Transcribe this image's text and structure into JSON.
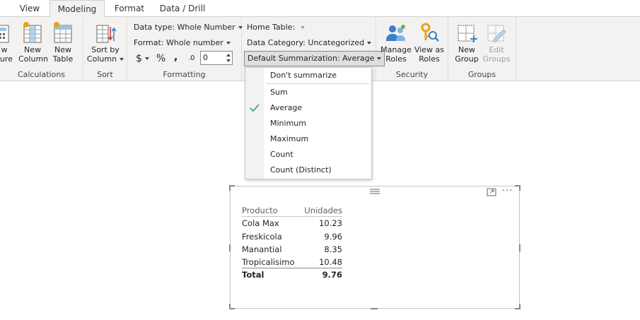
{
  "tabs": [
    "View",
    "Modeling",
    "Format",
    "Data / Drill"
  ],
  "ribbon": {
    "calculations": {
      "label": "Calculations",
      "new_measure": [
        "w",
        "sure"
      ],
      "new_column": [
        "New",
        "Column"
      ],
      "new_table": [
        "New",
        "Table"
      ]
    },
    "sort": {
      "label": "Sort",
      "sort_by_column": [
        "Sort by",
        "Column"
      ]
    },
    "formatting": {
      "label": "Formatting",
      "data_type": "Data type: Whole Number",
      "format": "Format: Whole number",
      "currency_symbol": "$",
      "percent_symbol": "%",
      "comma_symbol": ",",
      "decimal_symbol": ".0",
      "decimal_places": "0"
    },
    "properties": {
      "home_table": "Home Table:",
      "data_category": "Data Category: Uncategorized",
      "default_summarization": "Default Summarization: Average"
    },
    "security": {
      "label": "Security",
      "manage_roles": [
        "Manage",
        "Roles"
      ],
      "view_as_roles": [
        "View as",
        "Roles"
      ]
    },
    "groups": {
      "label": "Groups",
      "new_group": [
        "New",
        "Group"
      ],
      "edit_groups": [
        "Edit",
        "Groups"
      ]
    }
  },
  "summarization_menu": {
    "items": [
      "Don't summarize",
      "Sum",
      "Average",
      "Minimum",
      "Maximum",
      "Count",
      "Count (Distinct)"
    ],
    "selected": "Average"
  },
  "table_visual": {
    "columns": [
      "Producto",
      "Unidades"
    ],
    "rows": [
      [
        "Cola Max",
        "10.23"
      ],
      [
        "Freskicola",
        "9.96"
      ],
      [
        "Manantial",
        "8.35"
      ],
      [
        "Tropicalisimo",
        "10.48"
      ]
    ],
    "total": [
      "Total",
      "9.76"
    ]
  },
  "colors": {
    "ribbon_bg": "#f3f2f1",
    "accent_blue": "#3b7fc4",
    "check_green": "#4caf8a",
    "icon_gold": "#e8a317"
  }
}
